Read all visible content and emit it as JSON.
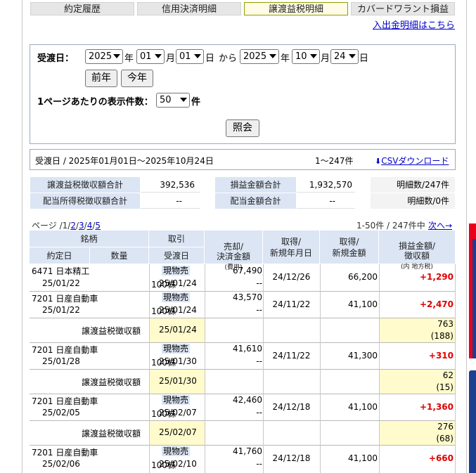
{
  "tabs": [
    {
      "label": "約定履歴",
      "active": false
    },
    {
      "label": "信用決済明細",
      "active": false
    },
    {
      "label": "譲渡益税明細",
      "active": true
    },
    {
      "label": "カバードワラント損益",
      "active": false
    }
  ],
  "cashflow_link": "入出金明細はこちら",
  "form": {
    "delivery_date_label": "受渡日：",
    "from_year": "2025",
    "from_month": "01",
    "from_day": "01",
    "to_year": "2025",
    "to_month": "10",
    "to_day": "24",
    "unit_year": "年",
    "unit_month": "月",
    "unit_day": "日",
    "from_text": "から",
    "prev_year_button": "前年",
    "this_year_button": "今年",
    "per_page_label": "1ページあたりの表示件数：",
    "per_page_value": "50",
    "per_page_unit": "件",
    "submit_button": "照会"
  },
  "summary": {
    "range_text": "受渡日 / 2025年01月01日〜2025年10月24日",
    "count_text": "1〜247件",
    "csv_link": "CSVダウンロード"
  },
  "totals": {
    "tax_total_label": "譲渡益税徴収額合計",
    "tax_total_value": "392,536",
    "pl_total_label": "損益金額合計",
    "pl_total_value": "1,932,570",
    "detail_count": "明細数/247件",
    "div_tax_label": "配当所得税徴収額合計",
    "div_tax_value": "--",
    "div_total_label": "配当金額合計",
    "div_total_value": "--",
    "div_detail_count": "明細数/0件"
  },
  "pagination": {
    "page_label": "ページ /",
    "pages": [
      "1",
      "2",
      "3",
      "4",
      "5"
    ],
    "range": "1-50件 / 247件中",
    "next": "次へ→"
  },
  "table_headers": {
    "brand": "銘柄",
    "trade_date": "約定日",
    "quantity": "数量",
    "transaction": "取引",
    "delivery_date": "受渡日",
    "sale_amount": "売却/\n決済金額",
    "sale_amount_sub": "(費用)",
    "acq_date": "取得/\n新規年月日",
    "acq_amount": "取得/\n新規金額",
    "pl_amount": "損益金額/\n徴収額",
    "pl_amount_sub": "(内 地方税)"
  },
  "tax_row_label": "譲渡益税徴収額",
  "rows": [
    {
      "type": "trade",
      "brand": "6471 日本精工",
      "trade_date": "25/01/22",
      "quantity": "100株",
      "transaction": "現物売",
      "delivery_date": "25/01/24",
      "sale": "67,490",
      "cost": "--",
      "acq_date": "24/12/26",
      "acq_amount": "66,200",
      "pl": "+1,290"
    },
    {
      "type": "trade",
      "brand": "7201 日産自動車",
      "trade_date": "25/01/22",
      "quantity": "100株",
      "transaction": "現物売",
      "delivery_date": "25/01/24",
      "sale": "43,570",
      "cost": "--",
      "acq_date": "24/11/22",
      "acq_amount": "41,100",
      "pl": "+2,470"
    },
    {
      "type": "tax",
      "delivery_date": "25/01/24",
      "tax": "763",
      "local": "(188)"
    },
    {
      "type": "trade",
      "brand": "7201 日産自動車",
      "trade_date": "25/01/28",
      "quantity": "100株",
      "transaction": "現物売",
      "delivery_date": "25/01/30",
      "sale": "41,610",
      "cost": "--",
      "acq_date": "24/11/22",
      "acq_amount": "41,300",
      "pl": "+310"
    },
    {
      "type": "tax",
      "delivery_date": "25/01/30",
      "tax": "62",
      "local": "(15)"
    },
    {
      "type": "trade",
      "brand": "7201 日産自動車",
      "trade_date": "25/02/05",
      "quantity": "100株",
      "transaction": "現物売",
      "delivery_date": "25/02/07",
      "sale": "42,460",
      "cost": "--",
      "acq_date": "24/12/18",
      "acq_amount": "41,100",
      "pl": "+1,360"
    },
    {
      "type": "tax",
      "delivery_date": "25/02/07",
      "tax": "276",
      "local": "(68)"
    },
    {
      "type": "trade",
      "brand": "7201 日産自動車",
      "trade_date": "25/02/06",
      "quantity": "100株",
      "transaction": "現物売",
      "delivery_date": "25/02/10",
      "sale": "41,760",
      "cost": "--",
      "acq_date": "24/12/18",
      "acq_amount": "41,100",
      "pl": "+660"
    }
  ],
  "colors": {
    "header_bg": "#dbe5f4",
    "profit": "#e00000",
    "tax_row_bg": "#fffbcc",
    "link": "#0000cc"
  }
}
